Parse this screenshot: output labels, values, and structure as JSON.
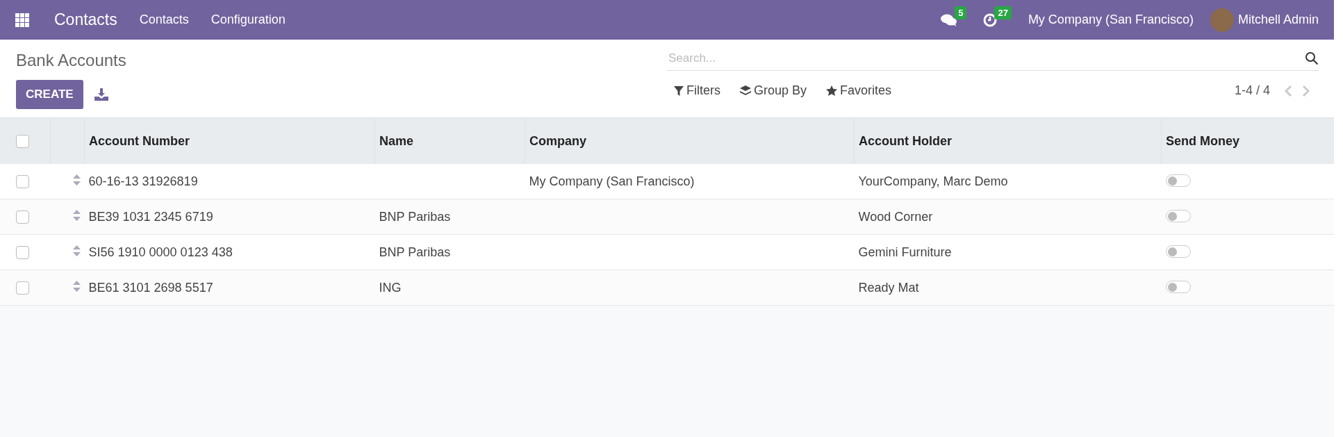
{
  "navbar": {
    "app_title": "Contacts",
    "menu": [
      "Contacts",
      "Configuration"
    ],
    "messages_count": "5",
    "activities_count": "27",
    "company": "My Company (San Francisco)",
    "user": "Mitchell Admin"
  },
  "page": {
    "title": "Bank Accounts",
    "create_button": "CREATE"
  },
  "search": {
    "placeholder": "Search..."
  },
  "filters": [
    {
      "kind": "filter",
      "label": "Filters"
    },
    {
      "kind": "group",
      "label": "Group By"
    },
    {
      "kind": "favorite",
      "label": "Favorites"
    }
  ],
  "pager": "1-4 / 4",
  "table": {
    "select_all_checked": false,
    "columns": [
      "Account Number",
      "Name",
      "Company",
      "Account Holder",
      "Send Money"
    ],
    "rows": [
      {
        "checked": false,
        "account_number": "60-16-13 31926819",
        "name": "",
        "company": "My Company (San Francisco)",
        "holder": "YourCompany, Marc Demo",
        "send_money": false
      },
      {
        "checked": false,
        "account_number": "BE39 1031 2345 6719",
        "name": "BNP Paribas",
        "company": "",
        "holder": "Wood Corner",
        "send_money": false
      },
      {
        "checked": false,
        "account_number": "SI56 1910 0000 0123 438",
        "name": "BNP Paribas",
        "company": "",
        "holder": "Gemini Furniture",
        "send_money": false
      },
      {
        "checked": false,
        "account_number": "BE61 3101 2698 5517",
        "name": "ING",
        "company": "",
        "holder": "Ready Mat",
        "send_money": false
      }
    ]
  }
}
